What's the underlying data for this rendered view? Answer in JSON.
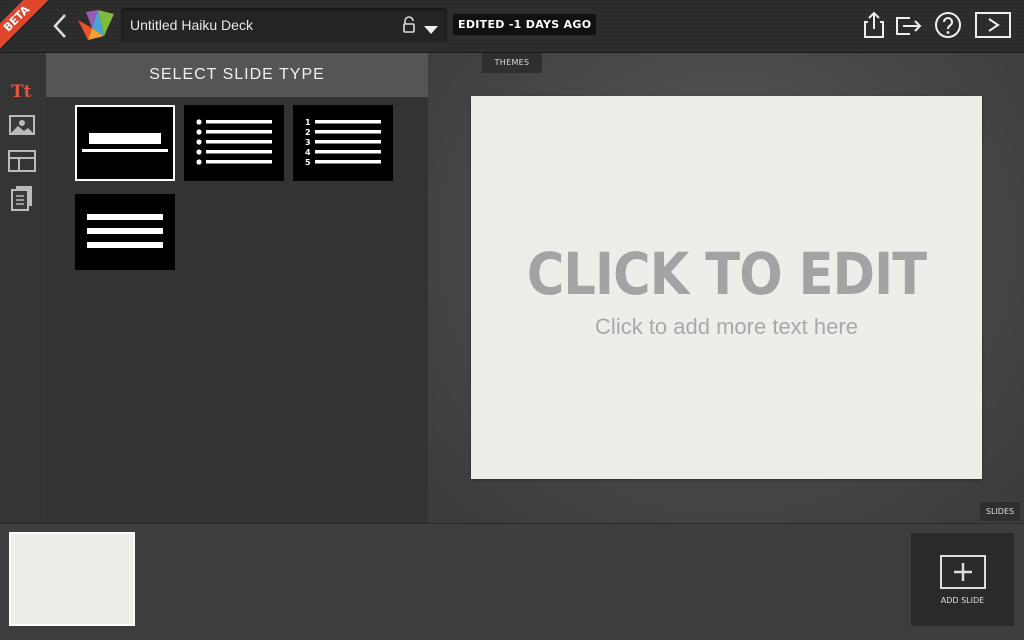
{
  "app": {
    "beta_badge": "BETA",
    "deck_title": "Untitled Haiku Deck",
    "edited_status": "EDITED -1 DAYS AGO"
  },
  "toolbar": {
    "icons": [
      "back-icon",
      "lock-icon",
      "caret-down-icon",
      "share-icon",
      "export-icon",
      "help-icon",
      "play-icon"
    ]
  },
  "sidebar": {
    "tools": [
      {
        "name": "text-tool",
        "label": "Tt",
        "active": true
      },
      {
        "name": "image-tool"
      },
      {
        "name": "layout-tool"
      },
      {
        "name": "notes-tool"
      }
    ]
  },
  "slide_type_panel": {
    "header": "SELECT SLIDE TYPE",
    "types": [
      {
        "name": "title-slide",
        "selected": true
      },
      {
        "name": "bullet-list-slide"
      },
      {
        "name": "numbered-list-slide",
        "numbers": [
          "1",
          "2",
          "3",
          "4",
          "5"
        ]
      },
      {
        "name": "text-lines-slide"
      }
    ]
  },
  "canvas": {
    "themes_tab": "THEMES",
    "slide_title": "CLICK TO EDIT",
    "slide_subtitle": "Click to add more text here",
    "slides_tab": "SLIDES"
  },
  "slide_strip": {
    "add_slide_label": "ADD SLIDE"
  },
  "colors": {
    "accent": "#e0563a",
    "beta": "#e0462c",
    "slide_bg": "#efedea"
  }
}
